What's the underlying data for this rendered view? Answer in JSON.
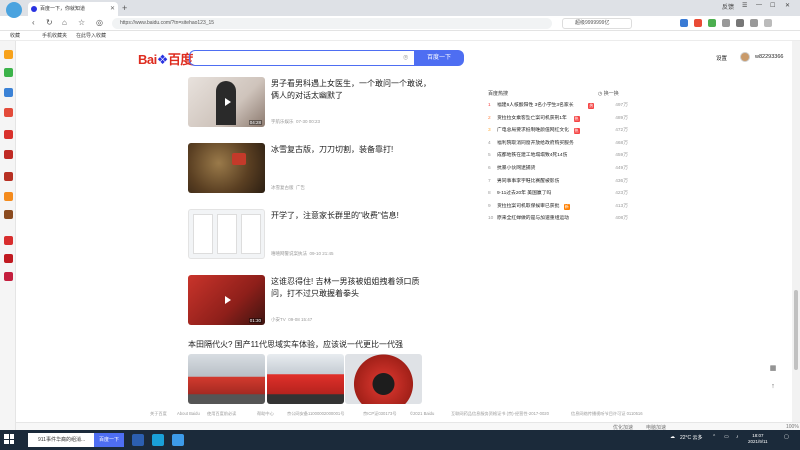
{
  "browser": {
    "tab_title": "百度一下，你就知道",
    "url": "https://www.baidu.com/?tn=sitehao123_15",
    "right_search_text": "超级9999999亿",
    "right_link": "反馈",
    "bookmarks": [
      "收藏",
      "手机收藏夹",
      "在此导入收藏"
    ]
  },
  "baidu": {
    "logo_bai": "Bai",
    "logo_du": "百度",
    "search_placeholder": "",
    "search_button": "百度一下",
    "settings": "设置",
    "username": "w82293366"
  },
  "feed": [
    {
      "title": "男子看男科遇上女医生，一个敢问一个敢说，俩人的对话太幽默了",
      "source": "宇航乐娱乐",
      "date": "07-30 00:23",
      "duration": "04:28",
      "is_video": true
    },
    {
      "title": "冰雪复古版，刀刀切割，装备靠打!",
      "source": "冰雪复古版",
      "date": "广告",
      "duration": "",
      "is_video": false
    },
    {
      "title": "开学了，注意家长群里的\"收费\"信息!",
      "source": "嘻嘻网警说案执法",
      "date": "09-10 21:45",
      "duration": "",
      "is_video": false
    },
    {
      "title": "这谁忍得住! 吉林一男孩被姐姐拽着领口质问，打不过只敢握着拳头",
      "source": "小安TV",
      "date": "09-08 15:47",
      "duration": "01:30",
      "is_video": true
    }
  ],
  "article": {
    "title": "本田隔代火? 国产11代思域实车体验，应该说一代更比一代强"
  },
  "hot": {
    "title": "百度热搜",
    "refresh": "换一换",
    "items": [
      {
        "idx": "1",
        "text": "福建6人核酸阳性 3名小学生3名家长",
        "tag": "热",
        "count": "497万"
      },
      {
        "idx": "2",
        "text": "货拉拉女乘客坠亡案司机获刑1年",
        "tag": "热",
        "count": "489万"
      },
      {
        "idx": "3",
        "text": "广电总局要求抵制唯颜值网红文化",
        "tag": "热",
        "count": "472万"
      },
      {
        "idx": "4",
        "text": "福利院取消同窗开放给政府购买服务",
        "tag": "",
        "count": "468万"
      },
      {
        "idx": "5",
        "text": "成都地铁在建工地塌塌致4死14伤",
        "tag": "",
        "count": "459万"
      },
      {
        "idx": "6",
        "text": "抗暴小伙网逮捕货",
        "tag": "",
        "count": "449万"
      },
      {
        "idx": "7",
        "text": "男同事事李宇鞋比赛醒被影伤",
        "tag": "",
        "count": "436万"
      },
      {
        "idx": "8",
        "text": "9·11过去20年 美国赢了吗",
        "tag": "",
        "count": "423万"
      },
      {
        "idx": "9",
        "text": "货拉拉案司机取保候审已获批",
        "tag": "新",
        "count": "413万"
      },
      {
        "idx": "10",
        "text": "原来全红婵做的是与加速重组运动",
        "tag": "",
        "count": "408万"
      }
    ]
  },
  "footer": [
    "关于百度",
    "About Baidu",
    "使用百度前必读",
    "帮助中心",
    "京公网安备11000002000001号",
    "京ICP证030173号",
    "©2021 Baidu",
    "互联网药品信息服务资格证书 (京)-经营性-2017-0020",
    "信息网络传播视听节目许可证 0110516"
  ],
  "statusbar": [
    "优化加速",
    "电脑加速",
    "100%"
  ],
  "taskbar": {
    "search_text": "911事件华裔的组消...",
    "search_button": "百度一下",
    "weather": "22°C 云多",
    "time": "18:07",
    "date": "2021/9/11"
  },
  "colors": {
    "baidu_blue": "#4e6ef2",
    "baidu_red": "#de2c1f",
    "hot_red": "#f54545",
    "hot_orange": "#ff7f00"
  }
}
